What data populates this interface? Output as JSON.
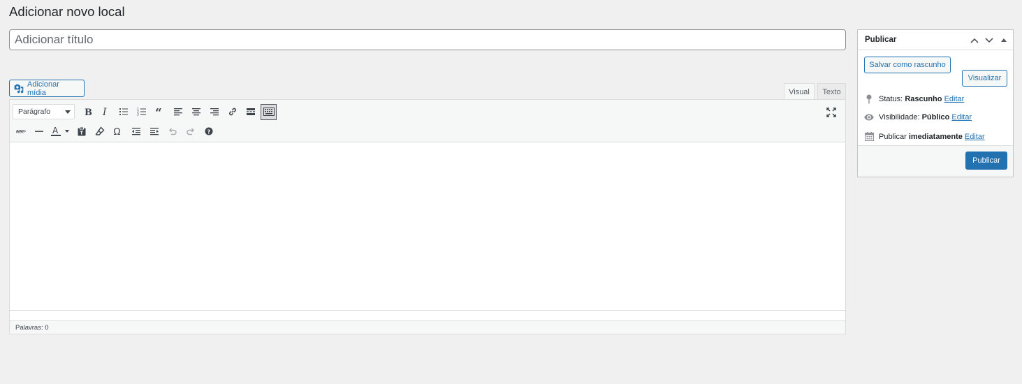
{
  "page": {
    "title": "Adicionar novo local"
  },
  "title_field": {
    "placeholder": "Adicionar título",
    "value": ""
  },
  "media": {
    "add_media_label": "Adicionar mídia",
    "icon": "add-media-icon"
  },
  "editor": {
    "tabs": [
      {
        "label": "Visual",
        "active": true
      },
      {
        "label": "Texto",
        "active": false
      }
    ],
    "format_select": {
      "value": "Parágrafo"
    },
    "toolbar_row1": [
      "bold-icon",
      "italic-icon",
      "bullet-list-icon",
      "numbered-list-icon",
      "blockquote-icon",
      "align-left-icon",
      "align-center-icon",
      "align-right-icon",
      "link-icon",
      "read-more-icon",
      "toolbar-toggle-icon"
    ],
    "toolbar_row2": [
      "strikethrough-icon",
      "horizontal-line-icon",
      "text-color-icon",
      "paste-text-icon",
      "clear-formatting-icon",
      "special-character-icon",
      "outdent-icon",
      "indent-icon",
      "undo-icon",
      "redo-icon",
      "help-icon"
    ],
    "word_count_label": "Palavras: 0"
  },
  "publish": {
    "title": "Publicar",
    "save_draft_label": "Salvar como rascunho",
    "preview_label": "Visualizar",
    "status_label": "Status:",
    "status_value": "Rascunho",
    "visibility_label": "Visibilidade:",
    "visibility_value": "Público",
    "schedule_label": "Publicar",
    "schedule_value": "imediatamente",
    "edit_label": "Editar",
    "publish_button": "Publicar",
    "colors": {
      "primary": "#2271b1"
    }
  }
}
